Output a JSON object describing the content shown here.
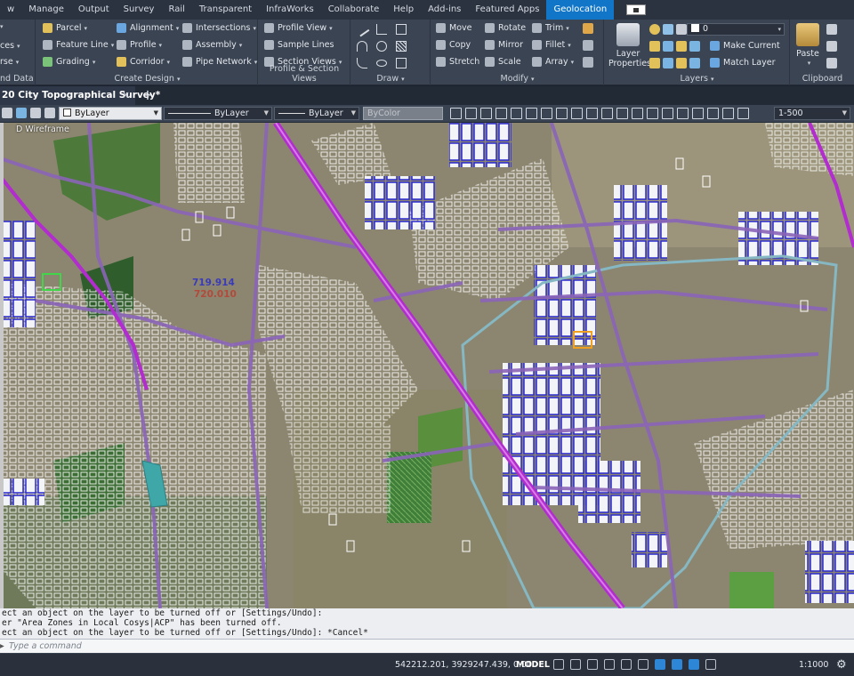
{
  "menubar": {
    "items": [
      "w",
      "Manage",
      "Output",
      "Survey",
      "Rail",
      "Transparent",
      "InfraWorks",
      "Collaborate",
      "Help",
      "Add-ins",
      "Featured Apps",
      "Geolocation"
    ],
    "active": "Geolocation"
  },
  "ribbon": {
    "panel0": {
      "items": [
        "ces",
        "rse",
        "nd Data"
      ],
      "label": ""
    },
    "create_design": {
      "items": [
        "Parcel",
        "Feature Line",
        "Grading",
        "Alignment",
        "Profile",
        "Corridor",
        "Intersections",
        "Assembly",
        "Pipe Network"
      ],
      "label": "Create Design"
    },
    "profile_section": {
      "items": [
        "Profile View",
        "Sample Lines",
        "Section Views"
      ],
      "label": "Profile & Section Views"
    },
    "draw": {
      "label": "Draw"
    },
    "modify": {
      "items": [
        "Move",
        "Rotate",
        "Trim",
        "Copy",
        "Mirror",
        "Fillet",
        "Stretch",
        "Scale",
        "Array"
      ],
      "label": "Modify"
    },
    "layers": {
      "layer_properties": "Layer Properties",
      "current_layer": "0",
      "make_current": "Make Current",
      "match_layer": "Match Layer",
      "label": "Layers"
    },
    "clipboard": {
      "paste": "Paste",
      "label": "Clipboard"
    }
  },
  "doc_tab": {
    "title": "20 City Topographical Survey*",
    "close": "×",
    "plus": "+"
  },
  "properties_toolbar": {
    "color": "ByLayer",
    "linetype": "ByLayer",
    "lineweight": "ByLayer",
    "plotstyle": "ByColor",
    "scale": "1-500"
  },
  "drawing": {
    "viewport_label": "D Wireframe",
    "elevation_1": "719.914",
    "elevation_2": "720.010"
  },
  "command_history": [
    "ect an object on the layer to be turned off or [Settings/Undo]:",
    "er \"Area Zones in Local Cosys|ACP\" has been turned off.",
    "ect an object on the layer to be turned off or [Settings/Undo]: *Cancel*"
  ],
  "command_line": {
    "placeholder": "Type a command"
  },
  "statusbar": {
    "coordinates": "542212.201, 3929247.439, 0.000",
    "model": "MODEL",
    "scale": "1:1000"
  }
}
